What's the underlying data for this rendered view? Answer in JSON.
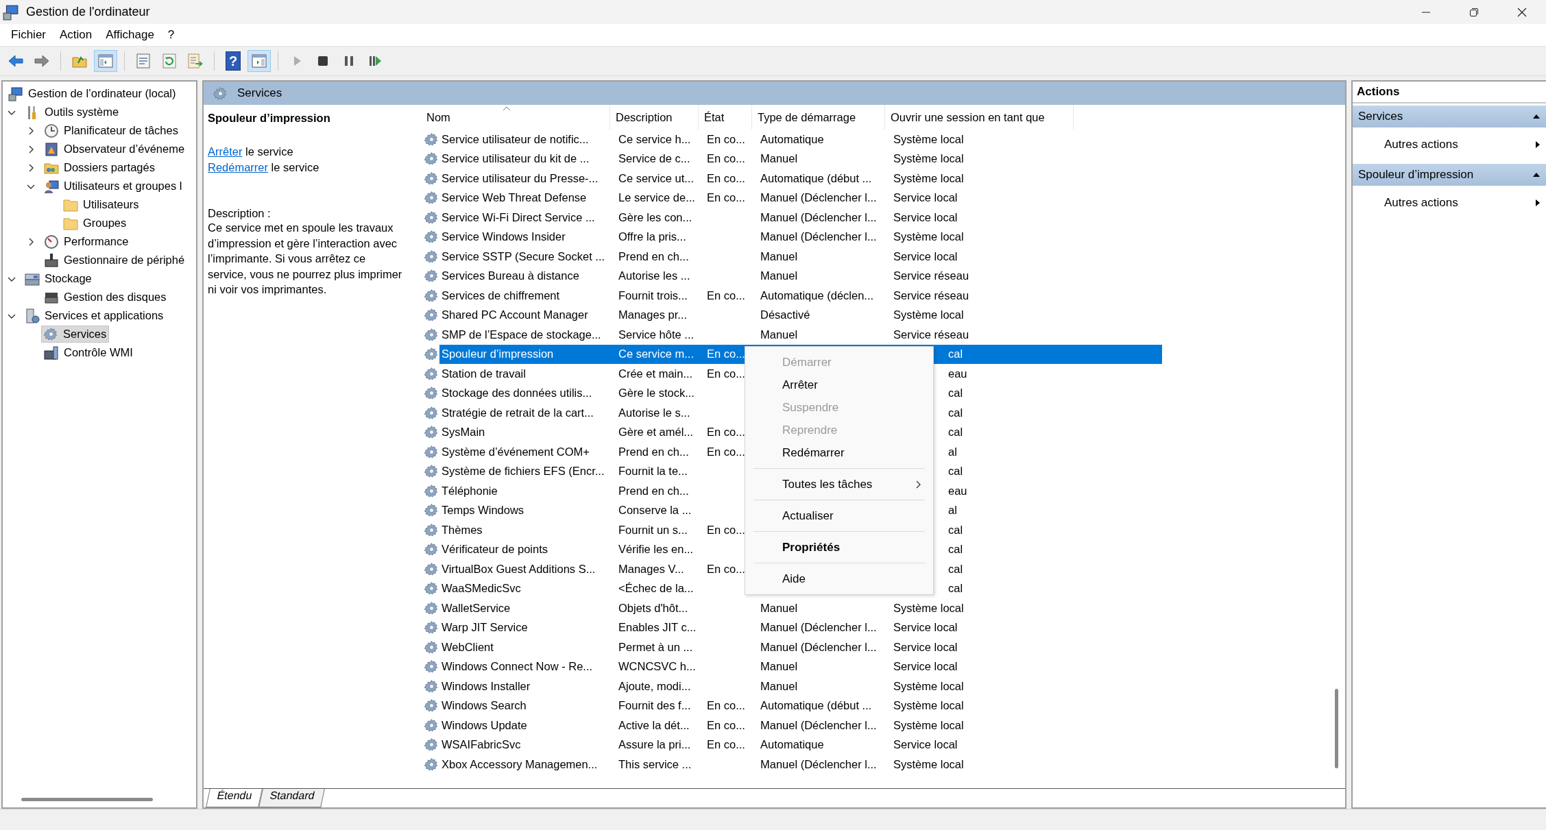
{
  "window": {
    "title": "Gestion de l'ordinateur"
  },
  "menu": [
    "Fichier",
    "Action",
    "Affichage",
    "?"
  ],
  "toolbar": [
    {
      "kind": "button",
      "pressed": false,
      "disabled": false
    },
    {
      "kind": "button",
      "pressed": false,
      "disabled": false
    },
    {
      "kind": "separator"
    },
    {
      "kind": "button",
      "pressed": false,
      "disabled": false
    },
    {
      "kind": "button",
      "pressed": true,
      "disabled": false
    },
    {
      "kind": "separator"
    },
    {
      "kind": "button",
      "pressed": false,
      "disabled": false
    },
    {
      "kind": "button",
      "pressed": false,
      "disabled": false
    },
    {
      "kind": "button",
      "pressed": false,
      "disabled": false
    },
    {
      "kind": "separator"
    },
    {
      "kind": "button",
      "glyph": "?",
      "pressed": false,
      "disabled": false
    },
    {
      "kind": "button",
      "pressed": true,
      "disabled": false
    },
    {
      "kind": "separator"
    },
    {
      "kind": "button",
      "pressed": false,
      "disabled": true
    },
    {
      "kind": "button",
      "pressed": false,
      "disabled": false
    },
    {
      "kind": "button",
      "pressed": false,
      "disabled": false
    },
    {
      "kind": "button",
      "pressed": false,
      "disabled": false
    }
  ],
  "tree": [
    {
      "label": "Gestion de l’ordinateur (local)",
      "selected": false,
      "children": [
        {
          "label": "Outils système",
          "expanded": true,
          "selected": false,
          "children": [
            {
              "label": "Planificateur de tâches",
              "expanded": false,
              "selected": false
            },
            {
              "label": "Observateur d’événeme",
              "expanded": false,
              "selected": false
            },
            {
              "label": "Dossiers partagés",
              "expanded": false,
              "selected": false
            },
            {
              "label": "Utilisateurs et groupes l",
              "expanded": true,
              "selected": false,
              "children": [
                {
                  "label": "Utilisateurs",
                  "selected": false
                },
                {
                  "label": "Groupes",
                  "selected": false
                }
              ]
            },
            {
              "label": "Performance",
              "expanded": false,
              "selected": false
            },
            {
              "label": "Gestionnaire de périphé",
              "selected": false
            }
          ]
        },
        {
          "label": "Stockage",
          "expanded": true,
          "selected": false,
          "children": [
            {
              "label": "Gestion des disques",
              "selected": false
            }
          ]
        },
        {
          "label": "Services et applications",
          "expanded": true,
          "selected": false,
          "children": [
            {
              "label": "Services",
              "selected": true
            },
            {
              "label": "Contrôle WMI",
              "selected": false
            }
          ]
        }
      ]
    }
  ],
  "panel": {
    "title": "Services",
    "heading": "Spouleur d’impression",
    "links": [
      {
        "link": "Arrêter",
        "text": "le service"
      },
      {
        "link": "Redémarrer",
        "text": "le service"
      }
    ],
    "description_label": "Description :",
    "description": "Ce service met en spoule les travaux d’impression et gère l’interaction avec l’imprimante.  Si vous arrêtez ce service, vous ne pourrez plus imprimer ni voir vos imprimantes."
  },
  "table": {
    "columns": [
      "Nom",
      "Description",
      "État",
      "Type de démarrage",
      "Ouvrir une session en tant que"
    ],
    "rows": [
      {
        "name": "Service utilisateur de notific...",
        "description": "Ce service h...",
        "status": "En co...",
        "start_type": "Automatique",
        "logon": "Système local",
        "selected": false
      },
      {
        "name": "Service utilisateur du kit de ...",
        "description": "Service de c...",
        "status": "En co...",
        "start_type": "Manuel",
        "logon": "Système local",
        "selected": false
      },
      {
        "name": "Service utilisateur du Presse-...",
        "description": "Ce service ut...",
        "status": "En co...",
        "start_type": "Automatique (début ...",
        "logon": "Système local",
        "selected": false
      },
      {
        "name": "Service Web Threat Defense",
        "description": "Le service de...",
        "status": "En co...",
        "start_type": "Manuel (Déclencher l...",
        "logon": "Service local",
        "selected": false
      },
      {
        "name": "Service Wi-Fi Direct Service ...",
        "description": "Gère les con...",
        "start_type": "Manuel (Déclencher l...",
        "logon": "Service local",
        "selected": false
      },
      {
        "name": "Service Windows Insider",
        "description": "Offre la pris...",
        "start_type": "Manuel (Déclencher l...",
        "logon": "Système local",
        "selected": false
      },
      {
        "name": "Service SSTP (Secure Socket ...",
        "description": "Prend en ch...",
        "start_type": "Manuel",
        "logon": "Service local",
        "selected": false
      },
      {
        "name": "Services Bureau à distance",
        "description": "Autorise les ...",
        "start_type": "Manuel",
        "logon": "Service réseau",
        "selected": false
      },
      {
        "name": "Services de chiffrement",
        "description": "Fournit trois...",
        "status": "En co...",
        "start_type": "Automatique (déclen...",
        "logon": "Service réseau",
        "selected": false
      },
      {
        "name": "Shared PC Account Manager",
        "description": "Manages pr...",
        "start_type": "Désactivé",
        "logon": "Système local",
        "selected": false
      },
      {
        "name": "SMP de l’Espace de stockage...",
        "description": "Service hôte ...",
        "start_type": "Manuel",
        "logon": "Service réseau",
        "selected": false
      },
      {
        "name": "Spouleur d’impression",
        "description": "Ce service m...",
        "status": "En co...",
        "logon": "cal",
        "under_menu": true,
        "selected": true
      },
      {
        "name": "Station de travail",
        "description": "Crée et main...",
        "status": "En co...",
        "logon": "eau",
        "under_menu": true,
        "selected": false
      },
      {
        "name": "Stockage des données utilis...",
        "description": "Gère le stock...",
        "logon": "cal",
        "under_menu": true,
        "selected": false
      },
      {
        "name": "Stratégie de retrait de la cart...",
        "description": "Autorise le s...",
        "logon": "cal",
        "under_menu": true,
        "selected": false
      },
      {
        "name": "SysMain",
        "description": "Gère et amél...",
        "status": "En co...",
        "logon": "cal",
        "under_menu": true,
        "selected": false
      },
      {
        "name": "Système d’événement COM+",
        "description": "Prend en ch...",
        "status": "En co...",
        "logon": "al",
        "under_menu": true,
        "selected": false
      },
      {
        "name": "Système de fichiers EFS (Encr...",
        "description": "Fournit la te...",
        "logon": "cal",
        "under_menu": true,
        "selected": false
      },
      {
        "name": "Téléphonie",
        "description": "Prend en ch...",
        "logon": "eau",
        "under_menu": true,
        "selected": false
      },
      {
        "name": "Temps Windows",
        "description": "Conserve la ...",
        "logon": "al",
        "under_menu": true,
        "selected": false
      },
      {
        "name": "Thèmes",
        "description": "Fournit un s...",
        "status": "En co...",
        "logon": "cal",
        "under_menu": true,
        "selected": false
      },
      {
        "name": "Vérificateur de points",
        "description": "Vérifie les en...",
        "logon": "cal",
        "under_menu": true,
        "selected": false
      },
      {
        "name": "VirtualBox Guest Additions S...",
        "description": "Manages V...",
        "status": "En co...",
        "logon": "cal",
        "under_menu": true,
        "selected": false
      },
      {
        "name": "WaaSMedicSvc",
        "description": "<Échec de la...",
        "logon": "cal",
        "under_menu": true,
        "selected": false
      },
      {
        "name": "WalletService",
        "description": "Objets d'hôt...",
        "start_type": "Manuel",
        "logon": "Système local",
        "selected": false
      },
      {
        "name": "Warp JIT Service",
        "description": "Enables JIT c...",
        "start_type": "Manuel (Déclencher l...",
        "logon": "Service local",
        "selected": false
      },
      {
        "name": "WebClient",
        "description": "Permet à un ...",
        "start_type": "Manuel (Déclencher l...",
        "logon": "Service local",
        "selected": false
      },
      {
        "name": "Windows Connect Now - Re...",
        "description": "WCNCSVC h...",
        "start_type": "Manuel",
        "logon": "Service local",
        "selected": false
      },
      {
        "name": "Windows Installer",
        "description": "Ajoute, modi...",
        "start_type": "Manuel",
        "logon": "Système local",
        "selected": false
      },
      {
        "name": "Windows Search",
        "description": "Fournit des f...",
        "status": "En co...",
        "start_type": "Automatique (début ...",
        "logon": "Système local",
        "selected": false
      },
      {
        "name": "Windows Update",
        "description": "Active la dét...",
        "status": "En co...",
        "start_type": "Manuel (Déclencher l...",
        "logon": "Système local",
        "selected": false
      },
      {
        "name": "WSAIFabricSvc",
        "description": "Assure la pri...",
        "status": "En co...",
        "start_type": "Automatique",
        "logon": "Service local",
        "selected": false
      },
      {
        "name": "Xbox Accessory Managemen...",
        "description": "This service ...",
        "start_type": "Manuel (Déclencher l...",
        "logon": "Système local",
        "selected": false
      }
    ]
  },
  "context_menu": [
    {
      "kind": "item",
      "label": "Démarrer",
      "disabled": true
    },
    {
      "kind": "item",
      "label": "Arrêter",
      "disabled": false
    },
    {
      "kind": "item",
      "label": "Suspendre",
      "disabled": true
    },
    {
      "kind": "item",
      "label": "Reprendre",
      "disabled": true
    },
    {
      "kind": "item",
      "label": "Redémarrer",
      "disabled": false
    },
    {
      "kind": "separator"
    },
    {
      "kind": "item",
      "label": "Toutes les tâches",
      "disabled": false,
      "submenu": true
    },
    {
      "kind": "separator"
    },
    {
      "kind": "item",
      "label": "Actualiser",
      "disabled": false
    },
    {
      "kind": "separator"
    },
    {
      "kind": "item",
      "label": "Propriétés",
      "disabled": false,
      "default": true
    },
    {
      "kind": "separator"
    },
    {
      "kind": "item",
      "label": "Aide",
      "disabled": false
    }
  ],
  "view_tabs": [
    {
      "label": "Étendu",
      "selected": true
    },
    {
      "label": "Standard",
      "selected": false
    }
  ],
  "actions": {
    "title": "Actions",
    "groups": [
      {
        "title": "Services",
        "expanded": true,
        "items": [
          "Autres actions"
        ]
      },
      {
        "title": "Spouleur d’impression",
        "expanded": true,
        "items": [
          "Autres actions"
        ]
      }
    ]
  }
}
